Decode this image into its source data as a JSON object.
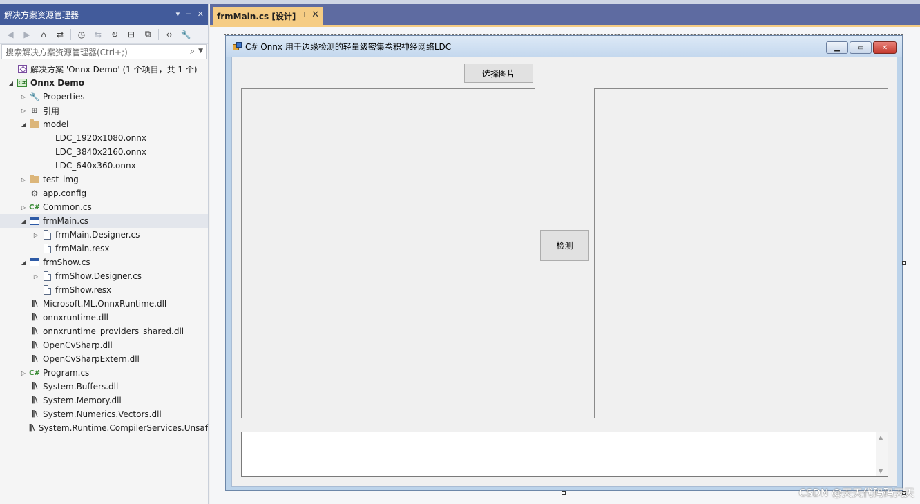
{
  "solution_explorer": {
    "title": "解决方案资源管理器",
    "controls": [
      "▾",
      "⊣",
      "✕"
    ],
    "search_placeholder": "搜索解决方案资源管理器(Ctrl+;)",
    "tree": [
      {
        "label": "解决方案 'Onnx Demo' (1 个项目，共 1 个)",
        "level": 0,
        "icon": "solution-icon",
        "expander": "",
        "bold": false
      },
      {
        "label": "Onnx Demo",
        "level": 0,
        "icon": "csproj-icon",
        "expander": "expanded",
        "bold": true
      },
      {
        "label": "Properties",
        "level": 1,
        "icon": "wrench-icon",
        "expander": "collapsed"
      },
      {
        "label": "引用",
        "level": 1,
        "icon": "references-icon",
        "expander": "collapsed"
      },
      {
        "label": "model",
        "level": 1,
        "icon": "folder-icon",
        "expander": "expanded"
      },
      {
        "label": "LDC_1920x1080.onnx",
        "level": 2,
        "icon": "none",
        "expander": ""
      },
      {
        "label": "LDC_3840x2160.onnx",
        "level": 2,
        "icon": "none",
        "expander": ""
      },
      {
        "label": "LDC_640x360.onnx",
        "level": 2,
        "icon": "none",
        "expander": ""
      },
      {
        "label": "test_img",
        "level": 1,
        "icon": "folder-icon",
        "expander": "collapsed"
      },
      {
        "label": "app.config",
        "level": 1,
        "icon": "config-icon",
        "expander": ""
      },
      {
        "label": "Common.cs",
        "level": 1,
        "icon": "csharp-icon",
        "expander": "collapsed"
      },
      {
        "label": "frmMain.cs",
        "level": 1,
        "icon": "form-icon",
        "expander": "expanded",
        "selected": true
      },
      {
        "label": "frmMain.Designer.cs",
        "level": 2,
        "icon": "file-icon",
        "expander": "collapsed"
      },
      {
        "label": "frmMain.resx",
        "level": 2,
        "icon": "file-icon",
        "expander": ""
      },
      {
        "label": "frmShow.cs",
        "level": 1,
        "icon": "form-icon",
        "expander": "expanded"
      },
      {
        "label": "frmShow.Designer.cs",
        "level": 2,
        "icon": "file-icon",
        "expander": "collapsed"
      },
      {
        "label": "frmShow.resx",
        "level": 2,
        "icon": "file-icon",
        "expander": ""
      },
      {
        "label": "Microsoft.ML.OnnxRuntime.dll",
        "level": 1,
        "icon": "dll-icon",
        "expander": ""
      },
      {
        "label": "onnxruntime.dll",
        "level": 1,
        "icon": "dll-icon",
        "expander": ""
      },
      {
        "label": "onnxruntime_providers_shared.dll",
        "level": 1,
        "icon": "dll-icon",
        "expander": ""
      },
      {
        "label": "OpenCvSharp.dll",
        "level": 1,
        "icon": "dll-icon",
        "expander": ""
      },
      {
        "label": "OpenCvSharpExtern.dll",
        "level": 1,
        "icon": "dll-icon",
        "expander": ""
      },
      {
        "label": "Program.cs",
        "level": 1,
        "icon": "csharp-icon",
        "expander": "collapsed"
      },
      {
        "label": "System.Buffers.dll",
        "level": 1,
        "icon": "dll-icon",
        "expander": ""
      },
      {
        "label": "System.Memory.dll",
        "level": 1,
        "icon": "dll-icon",
        "expander": ""
      },
      {
        "label": "System.Numerics.Vectors.dll",
        "level": 1,
        "icon": "dll-icon",
        "expander": ""
      },
      {
        "label": "System.Runtime.CompilerServices.Unsaf",
        "level": 1,
        "icon": "dll-icon",
        "expander": ""
      }
    ]
  },
  "editor_tab": {
    "label": "frmMain.cs [设计]",
    "pin": "⊣",
    "close": "✕"
  },
  "form": {
    "title": "C# Onnx 用于边缘检测的轻量级密集卷积神经网络LDC",
    "select_button": "选择图片",
    "detect_button": "检测"
  },
  "watermark": "CSDN @天天代码码天天",
  "colors": {
    "tab_active": "#f5cc84",
    "panel_title": "#425b9b",
    "tab_bar": "#5e6ba1"
  }
}
